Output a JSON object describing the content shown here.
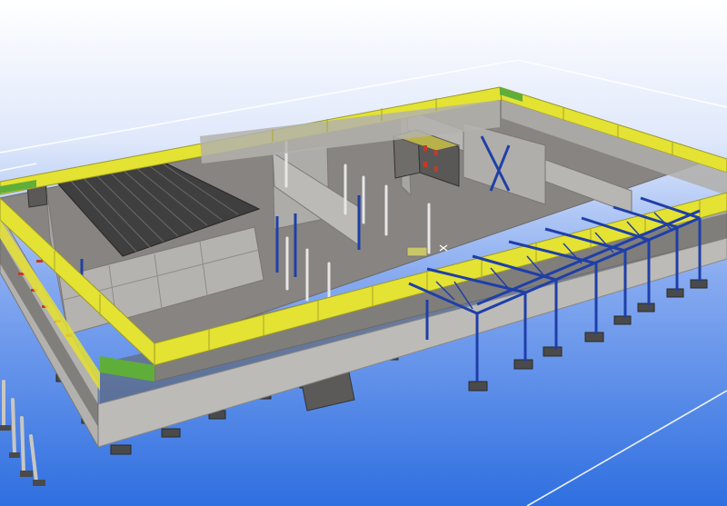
{
  "viewport": {
    "view_type": "3d-model-viewport",
    "background_top_color": "#ffffff",
    "background_bottom_color": "#2f6fe0"
  },
  "colors": {
    "parapet_yellow": "#e4e233",
    "parapet_stripe_green": "#5fae3a",
    "wall_grey": "#b9b7b3",
    "wall_dark_band": "#5f5d5b",
    "floor_grey": "#858280",
    "roof_panels": "#3f3f3f",
    "steel_blue": "#1f3fa8",
    "footing_dark": "#4a4a4a",
    "column_white": "#e6e6e6",
    "work_plane_line": "#ffffff"
  },
  "model": {
    "description_icons": [
      "warehouse-building-model",
      "steel-frame-canopy",
      "rooftop-module"
    ]
  }
}
